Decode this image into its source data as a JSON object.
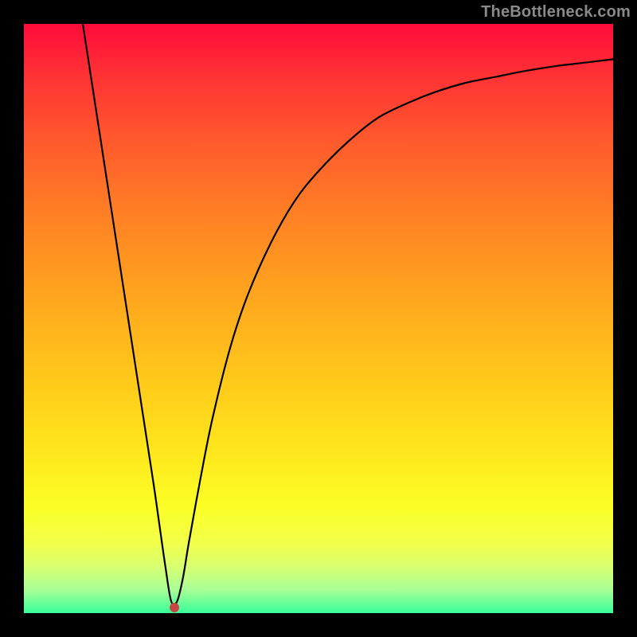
{
  "watermark": "TheBottleneck.com",
  "marker": {
    "x_pct": 25.5,
    "y_pct": 99.0
  },
  "chart_data": {
    "type": "line",
    "title": "",
    "xlabel": "",
    "ylabel": "",
    "xlim": [
      0,
      100
    ],
    "ylim": [
      0,
      100
    ],
    "grid": false,
    "legend": false,
    "series": [
      {
        "name": "bottleneck-curve",
        "x": [
          10,
          12,
          14,
          16,
          18,
          20,
          22,
          23,
          24,
          25,
          26,
          27,
          28,
          30,
          32,
          35,
          38,
          42,
          46,
          50,
          55,
          60,
          65,
          70,
          75,
          80,
          85,
          90,
          95,
          100
        ],
        "y": [
          100,
          87,
          74,
          61,
          48,
          35,
          22,
          15,
          8,
          2,
          2,
          6,
          12,
          23,
          33,
          45,
          54,
          63,
          70,
          75,
          80,
          84,
          86.5,
          88.5,
          90,
          91,
          92,
          92.8,
          93.4,
          94
        ]
      }
    ],
    "annotations": [
      {
        "type": "point",
        "name": "optimum",
        "x": 25.5,
        "y": 1
      }
    ],
    "background_gradient": {
      "orientation": "vertical",
      "stops": [
        {
          "pct": 0,
          "color": "#ff0b3b"
        },
        {
          "pct": 20,
          "color": "#ff5a2d"
        },
        {
          "pct": 46,
          "color": "#ffa51e"
        },
        {
          "pct": 72,
          "color": "#ffe51c"
        },
        {
          "pct": 88,
          "color": "#f2ff4a"
        },
        {
          "pct": 100,
          "color": "#39ff9a"
        }
      ]
    }
  }
}
